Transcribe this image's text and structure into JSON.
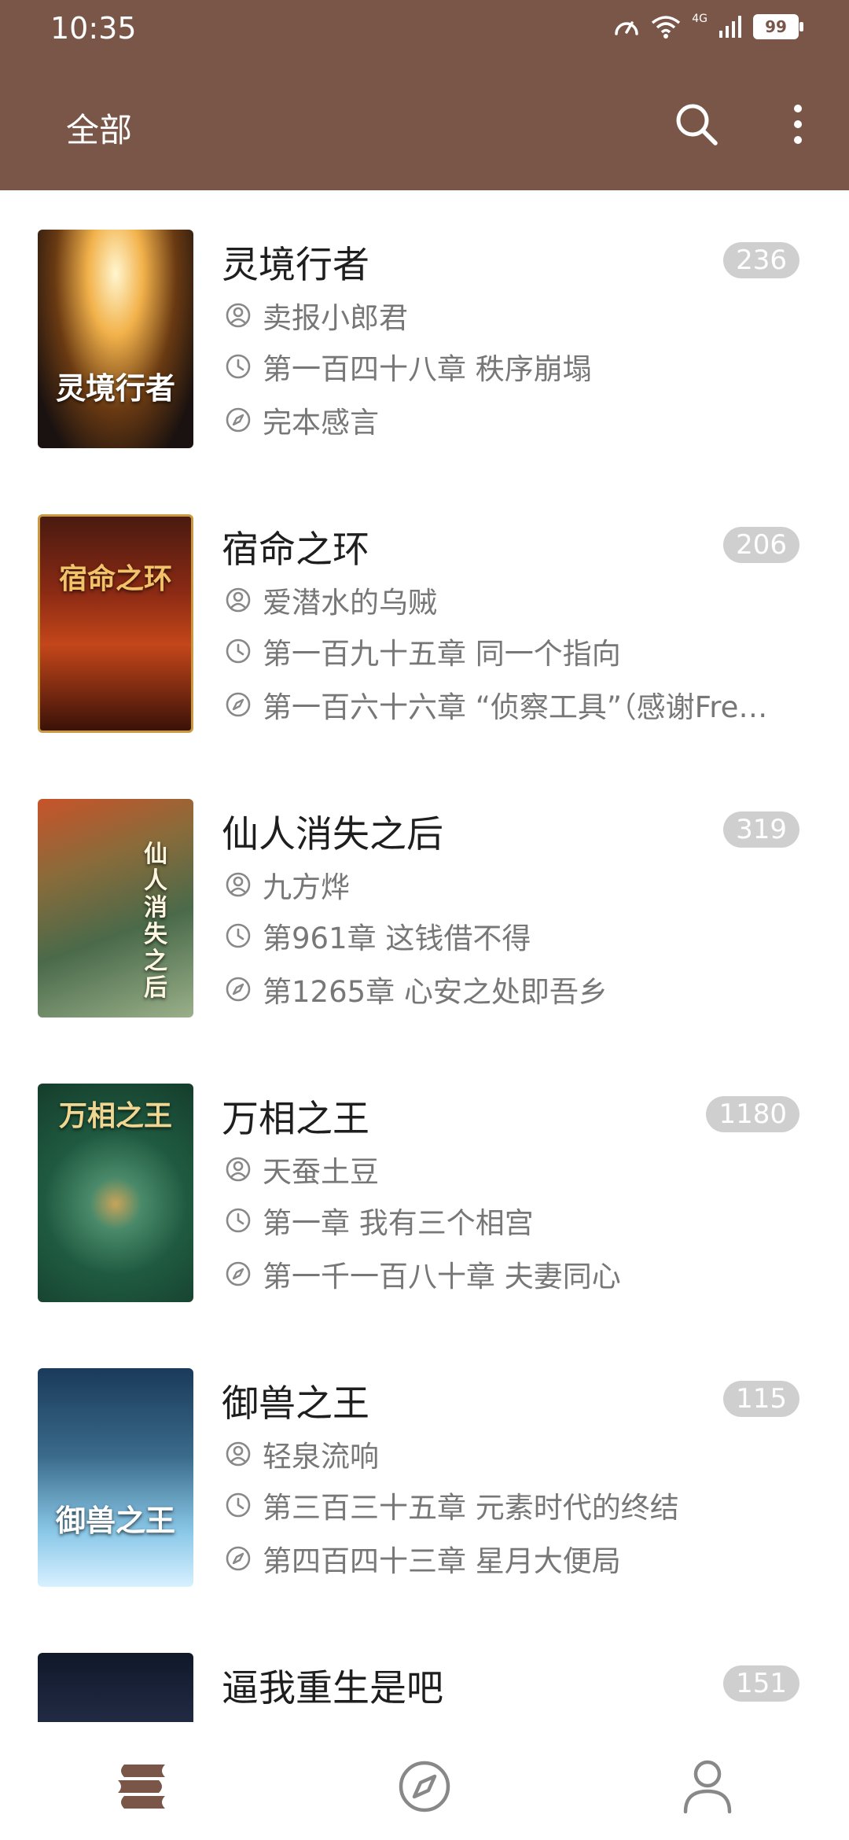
{
  "status_bar": {
    "time": "10:35",
    "network": "4G",
    "battery": "99"
  },
  "header": {
    "title": "全部"
  },
  "books": [
    {
      "title": "灵境行者",
      "count": "236",
      "author": "卖报小郎君",
      "latest_chapter": "第一百四十八章 秩序崩塌",
      "last_read": "完本感言",
      "cover_text": "灵境行者"
    },
    {
      "title": "宿命之环",
      "count": "206",
      "author": "爱潜水的乌贼",
      "latest_chapter": "第一百九十五章 同一个指向",
      "last_read": "第一百六十六章 “侦察工具”（感谢Fre…",
      "cover_text": "宿命之环"
    },
    {
      "title": "仙人消失之后",
      "count": "319",
      "author": "九方烨",
      "latest_chapter": "第961章 这钱借不得",
      "last_read": "第1265章 心安之处即吾乡",
      "cover_text": "仙人消失之后"
    },
    {
      "title": "万相之王",
      "count": "1180",
      "author": "天蚕土豆",
      "latest_chapter": "第一章 我有三个相宫",
      "last_read": "第一千一百八十章 夫妻同心",
      "cover_text": "万相之王"
    },
    {
      "title": "御兽之王",
      "count": "115",
      "author": "轻泉流响",
      "latest_chapter": "第三百三十五章 元素时代的终结",
      "last_read": "第四百四十三章 星月大便局",
      "cover_text": "御兽之王"
    },
    {
      "title": "逼我重生是吧",
      "count": "151"
    }
  ],
  "icons": {
    "search": "search-icon",
    "more": "more-vertical-icon",
    "author": "person-circle-icon",
    "latest": "clock-icon",
    "read": "compass-icon",
    "nav_bookshelf": "bookshelf-icon",
    "nav_explore": "compass-icon",
    "nav_profile": "person-icon"
  },
  "colors": {
    "header_bg": "#7a5648",
    "badge_bg": "#cfcfcf",
    "meta_text": "#777777",
    "nav_active": "#7a5648",
    "nav_inactive": "#888888"
  }
}
